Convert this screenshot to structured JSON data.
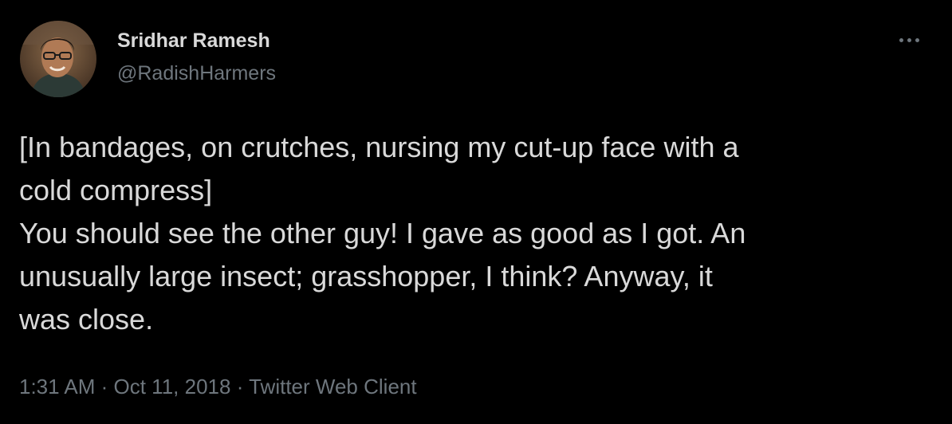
{
  "author": {
    "display_name": "Sridhar Ramesh",
    "handle": "@RadishHarmers",
    "avatar_icon": "profile-photo"
  },
  "menu": {
    "icon": "more-horizontal-icon"
  },
  "tweet": {
    "lines": [
      "[In bandages, on crutches, nursing my cut-up face with a",
      "cold compress]",
      "You should see the other guy! I gave as good as I got. An",
      "unusually large insect; grasshopper, I think? Anyway, it",
      "was close."
    ]
  },
  "meta": {
    "time": "1:31 AM",
    "separator": " · ",
    "date": "Oct 11, 2018",
    "client": "Twitter Web Client"
  },
  "colors": {
    "background": "#000000",
    "primary_text": "#d9d9d9",
    "secondary_text": "#6e767d"
  }
}
